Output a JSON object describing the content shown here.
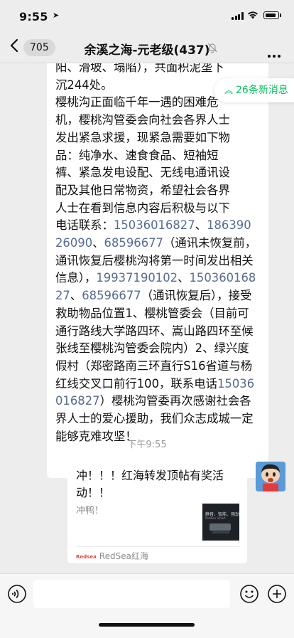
{
  "status_bar": {
    "time": "9:55"
  },
  "nav": {
    "back_count": "705",
    "title": "余溪之海-元老级(437)"
  },
  "chat": {
    "incoming_message": {
      "lines": [
        "阳、滑坡、塌陷），共面积泥垄下",
        "沉244处。",
        "樱桃沟正面临千年一遇的困难危",
        "机，樱桃沟管委会向社会各界人士",
        "发出紧急求援，现紧急需要如下物",
        "品：纯净水、速食食品、短袖短",
        "裤、紧急发电设配、无线电通讯设",
        "配及其他日常物资，希望社会各界",
        "人士在看到信息内容后积极与以下",
        "电话联系："
      ],
      "phone_1": "15036016827",
      "sep_1": "、",
      "phone_2": "18639026090",
      "sep_2": "、",
      "phone_3": "68596677",
      "text_after_3": "（通讯未恢复前，通讯恢复后樱桃沟将第一时间发出相关信息），",
      "phone_4": "19937190102",
      "sep_4": "、",
      "phone_5": "15036016827",
      "sep_5": "、",
      "phone_6": "68596677",
      "text_after_6": "（通讯恢复后），接受救助物品位置1、樱桃管委会（目前可通行路线大学路四环、嵩山路四环至候张线至樱桃沟管委会院内）2、绿兴度假村（郑密路南三环直行S16省道与杨红线交叉口前行100，联系电话",
      "phone_7": "15036016827",
      "text_end": "）樱桃沟管委再次感谢社会各界人士的爱心援助，我们众志成城一定能够克难攻坚！"
    },
    "new_messages_pill": "26条新消息",
    "timestamp": "下午9:55",
    "card": {
      "title": "冲！！！红海转发顶帖有奖活动！！",
      "description": "冲鸭！",
      "thumb_text_1": "静音、智能、强劲",
      "thumb_text_2": "RedSea Smart",
      "source_name": "RedSea红海",
      "source_logo": "Redsea"
    }
  },
  "icons": {
    "back": "chevron-left-icon",
    "mute": "bell-slash-icon",
    "more": "more-dots-icon",
    "voice": "voice-icon",
    "emoji": "emoji-icon",
    "plus": "plus-icon"
  },
  "colors": {
    "link": "#576b95",
    "accent_green": "#07c160",
    "background": "#ededed"
  }
}
